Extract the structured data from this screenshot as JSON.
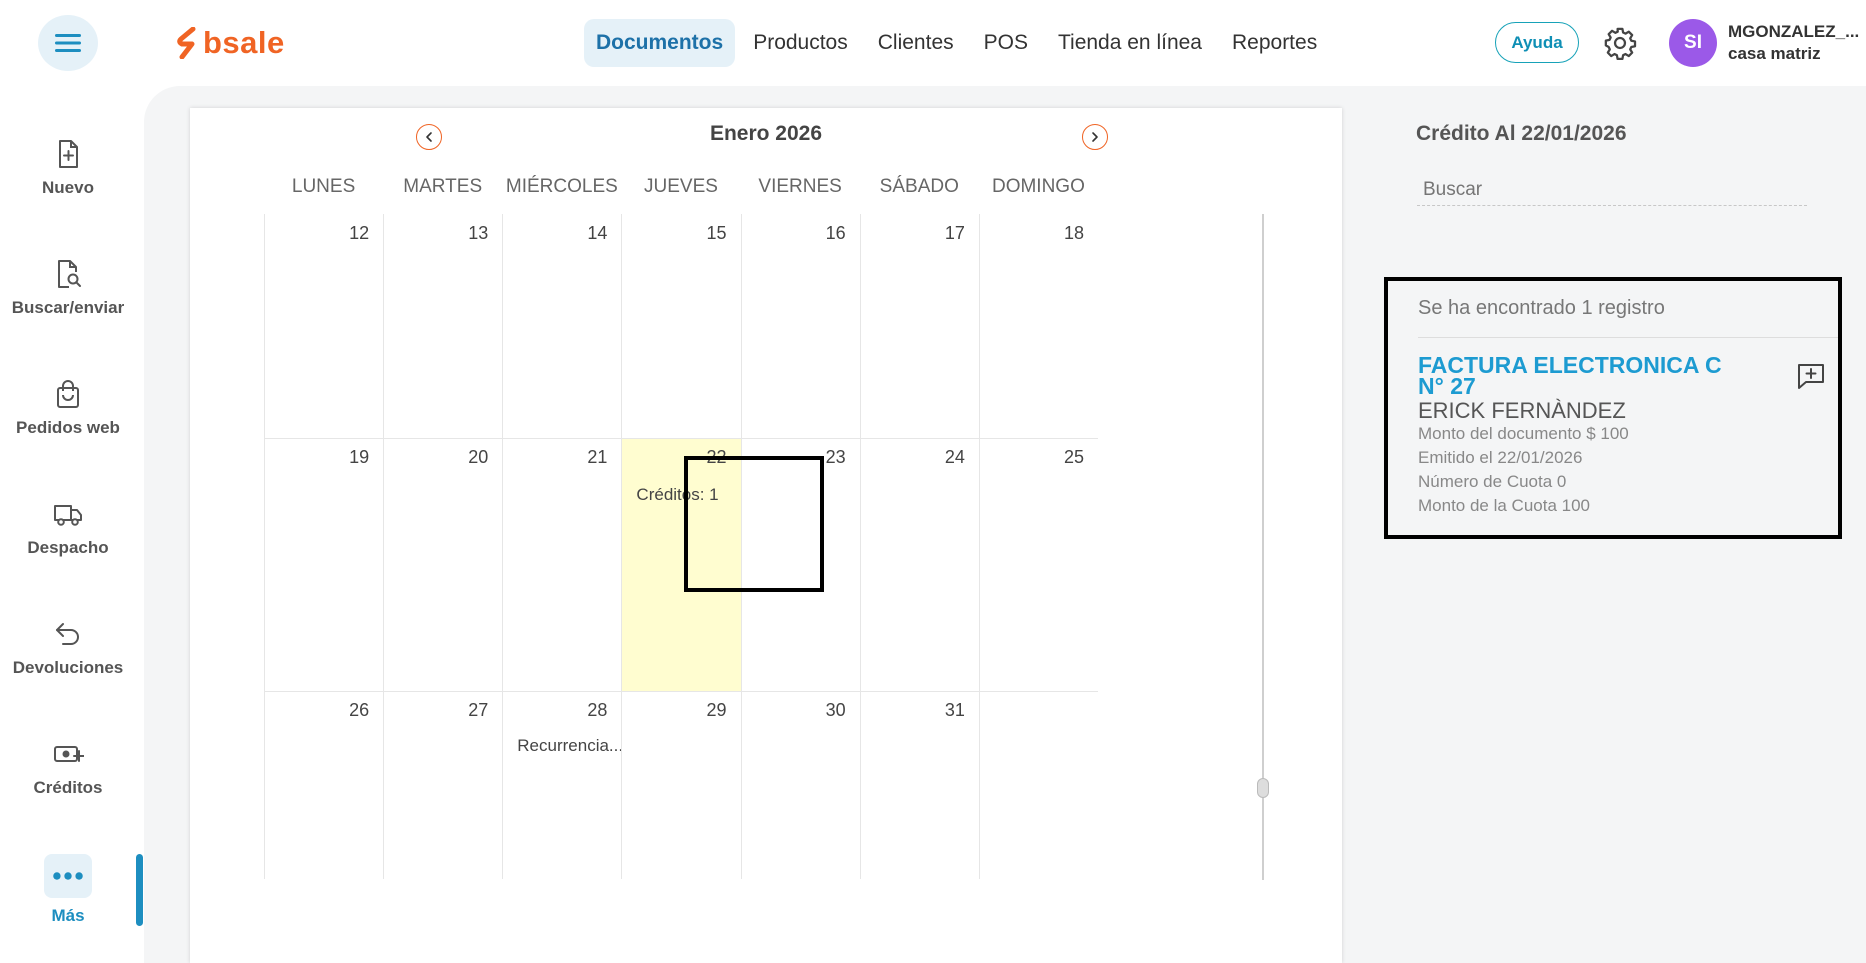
{
  "app": {
    "logo_text": "bsale",
    "brand_color": "#f06424",
    "accent_color": "#1d8ec0"
  },
  "header": {
    "nav": [
      {
        "label": "Documentos",
        "active": true
      },
      {
        "label": "Productos"
      },
      {
        "label": "Clientes"
      },
      {
        "label": "POS"
      },
      {
        "label": "Tienda en línea"
      },
      {
        "label": "Reportes"
      }
    ],
    "help_label": "Ayuda",
    "avatar_initials": "SI",
    "user_name": "MGONZALEZ_...",
    "branch": "casa matriz"
  },
  "sidebar": {
    "items": [
      {
        "label": "Nuevo",
        "icon": "new-document-icon"
      },
      {
        "label": "Buscar/enviar",
        "icon": "search-document-icon"
      },
      {
        "label": "Pedidos web",
        "icon": "shopping-bag-icon"
      },
      {
        "label": "Despacho",
        "icon": "truck-icon"
      },
      {
        "label": "Devoluciones",
        "icon": "return-arrow-icon"
      },
      {
        "label": "Créditos",
        "icon": "money-icon"
      },
      {
        "label": "Más",
        "icon": "more-dots-icon",
        "active": true
      }
    ]
  },
  "calendar": {
    "month_title": "Enero 2026",
    "weekdays": [
      "LUNES",
      "MARTES",
      "MIÉRCOLES",
      "JUEVES",
      "VIERNES",
      "SÁBADO",
      "DOMINGO"
    ],
    "weeks": [
      {
        "days": [
          {
            "num": "12"
          },
          {
            "num": "13"
          },
          {
            "num": "14"
          },
          {
            "num": "15"
          },
          {
            "num": "16"
          },
          {
            "num": "17"
          },
          {
            "num": "18"
          }
        ]
      },
      {
        "days": [
          {
            "num": "19"
          },
          {
            "num": "20"
          },
          {
            "num": "21"
          },
          {
            "num": "22",
            "event": "Créditos: 1",
            "today": true
          },
          {
            "num": "23"
          },
          {
            "num": "24"
          },
          {
            "num": "25"
          }
        ]
      },
      {
        "days": [
          {
            "num": "26"
          },
          {
            "num": "27"
          },
          {
            "num": "28",
            "event": "Recurrencia..."
          },
          {
            "num": "29"
          },
          {
            "num": "30"
          },
          {
            "num": "31"
          },
          {
            "num": ""
          }
        ]
      }
    ]
  },
  "panel": {
    "title": "Crédito Al 22/01/2026",
    "search_placeholder": "Buscar",
    "result_count": "Se ha encontrado 1 registro",
    "document": {
      "title": "FACTURA ELECTRONICA C N° 27",
      "client": "ERICK FERNÀNDEZ",
      "lines": [
        "Monto del documento $ 100",
        "Emitido el 22/01/2026",
        "Número de Cuota 0",
        "Monto de la Cuota 100"
      ]
    }
  }
}
